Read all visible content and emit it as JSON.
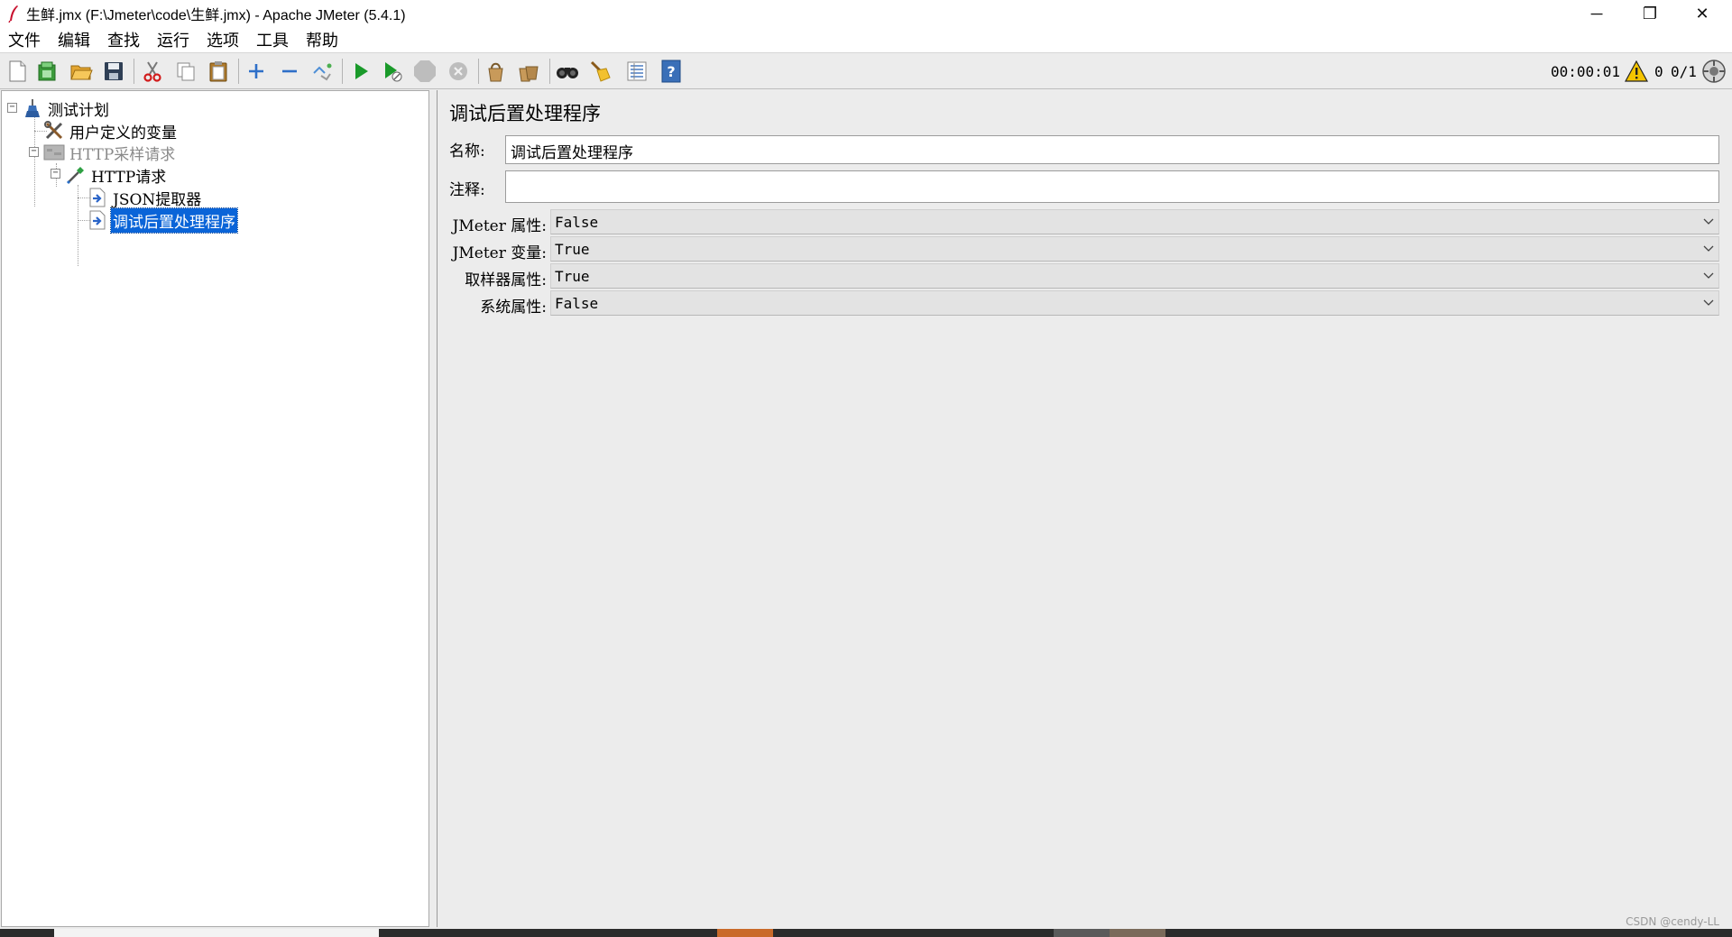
{
  "window": {
    "title": "生鲜.jmx (F:\\Jmeter\\code\\生鲜.jmx) - Apache JMeter (5.4.1)",
    "controls": {
      "minimize": "─",
      "restore": "❐",
      "close": "✕"
    }
  },
  "menubar": {
    "items": [
      {
        "label": "文件"
      },
      {
        "label": "编辑"
      },
      {
        "label": "查找"
      },
      {
        "label": "运行"
      },
      {
        "label": "选项"
      },
      {
        "label": "工具"
      },
      {
        "label": "帮助"
      }
    ]
  },
  "toolbar": {
    "icons": [
      "new-file-icon",
      "templates-icon",
      "open-icon",
      "save-icon",
      "cut-icon",
      "copy-icon",
      "paste-icon",
      "expand-icon",
      "collapse-icon",
      "toggle-icon",
      "start-icon",
      "start-no-pause-icon",
      "stop-icon",
      "shutdown-icon",
      "clear-icon",
      "clear-all-icon",
      "search-icon",
      "reset-search-icon",
      "function-helper-icon",
      "help-icon"
    ],
    "timer": "00:00:01",
    "warning_count": "0",
    "threads": "0/1"
  },
  "tree": {
    "nodes": [
      {
        "label": "测试计划",
        "icon": "test-plan-icon"
      },
      {
        "label": "用户定义的变量",
        "icon": "config-tools-icon"
      },
      {
        "label": "HTTP采样请求",
        "icon": "thread-group-icon",
        "disabled": true
      },
      {
        "label": "HTTP请求",
        "icon": "sampler-pipette-icon"
      },
      {
        "label": "JSON提取器",
        "icon": "post-processor-icon"
      },
      {
        "label": "调试后置处理程序",
        "icon": "post-processor-icon",
        "selected": true
      }
    ]
  },
  "panel": {
    "title": "调试后置处理程序",
    "name_label": "名称:",
    "name_value": "调试后置处理程序",
    "comments_label": "注释:",
    "comments_value": "",
    "fields": [
      {
        "label": "JMeter 属性:",
        "value": "False"
      },
      {
        "label": "JMeter 变量:",
        "value": "True"
      },
      {
        "label": "取样器属性:",
        "value": "True"
      },
      {
        "label": "系统属性:",
        "value": "False"
      }
    ]
  },
  "watermark": "CSDN @cendy-LL",
  "colors": {
    "selection": "#0a64d8",
    "panel_bg": "#ececec",
    "play_green": "#1a9a2a"
  }
}
